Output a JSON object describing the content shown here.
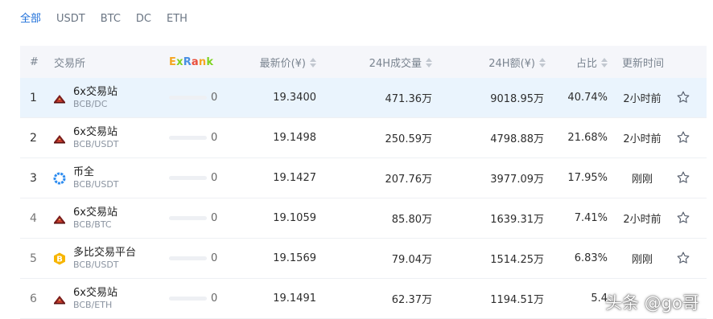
{
  "tabs": [
    {
      "label": "全部",
      "active": true
    },
    {
      "label": "USDT",
      "active": false
    },
    {
      "label": "BTC",
      "active": false
    },
    {
      "label": "DC",
      "active": false
    },
    {
      "label": "ETH",
      "active": false
    }
  ],
  "header": {
    "index": "#",
    "exchange": "交易所",
    "exrank_parts": [
      "E",
      "x",
      "R",
      "a",
      "n",
      "k"
    ],
    "exrank_colors": [
      "#f5a623",
      "#7ed321",
      "#4a90e2",
      "#e94e3c",
      "#f5a623",
      "#7ed321"
    ],
    "price": "最新价(¥)",
    "volume": "24H成交量",
    "amount": "24H额(¥)",
    "share": "占比",
    "updated": "更新时间"
  },
  "rows": [
    {
      "index": "1",
      "name": "6x交易站",
      "pair": "BCB/DC",
      "logo": "6x-exchange-icon",
      "score": "0",
      "price": "19.3400",
      "volume": "471.36万",
      "amount": "9018.95万",
      "share": "40.74%",
      "updated": "2小时前",
      "highlight": true
    },
    {
      "index": "2",
      "name": "6x交易站",
      "pair": "BCB/USDT",
      "logo": "6x-exchange-icon",
      "score": "0",
      "price": "19.1498",
      "volume": "250.59万",
      "amount": "4798.88万",
      "share": "21.68%",
      "updated": "2小时前",
      "highlight": false
    },
    {
      "index": "3",
      "name": "币全",
      "pair": "BCB/USDT",
      "logo": "biquan-icon",
      "score": "0",
      "price": "19.1427",
      "volume": "207.76万",
      "amount": "3977.09万",
      "share": "17.95%",
      "updated": "刚刚",
      "highlight": false
    },
    {
      "index": "4",
      "name": "6x交易站",
      "pair": "BCB/BTC",
      "logo": "6x-exchange-icon",
      "score": "0",
      "price": "19.1059",
      "volume": "85.80万",
      "amount": "1639.31万",
      "share": "7.41%",
      "updated": "2小时前",
      "highlight": false
    },
    {
      "index": "5",
      "name": "多比交易平台",
      "pair": "BCB/USDT",
      "logo": "dobi-icon",
      "score": "0",
      "price": "19.1569",
      "volume": "79.04万",
      "amount": "1514.25万",
      "share": "6.83%",
      "updated": "刚刚",
      "highlight": false
    },
    {
      "index": "6",
      "name": "6x交易站",
      "pair": "BCB/ETH",
      "logo": "6x-exchange-icon",
      "score": "0",
      "price": "19.1491",
      "volume": "62.37万",
      "amount": "1194.51万",
      "share": "5.4",
      "updated": "",
      "highlight": false
    }
  ],
  "watermark": "头条 @go哥",
  "colors": {
    "accent": "#1e6fd9",
    "highlight_row": "#eaf4fd",
    "header_bg": "#f5f6fa"
  }
}
